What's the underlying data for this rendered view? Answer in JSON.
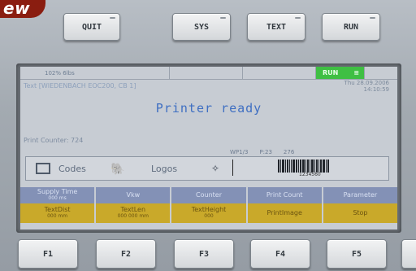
{
  "badge": {
    "text": "ew"
  },
  "top_buttons": [
    "QUIT",
    "SYS",
    "TEXT",
    "RUN"
  ],
  "status": {
    "cell1": "102% 6lbs",
    "run": "RUN"
  },
  "text_line": "Text [WIEDENBACH EOC200, CB 1]",
  "datetime": {
    "date": "Thu 28.09.2006",
    "time": "14:10:59"
  },
  "message": "Printer ready",
  "print_counter": "Print Counter:  724",
  "metrics": [
    "WP1/3",
    "P:23",
    "276"
  ],
  "preview": {
    "codes": "Codes",
    "logos": "Logos",
    "barcode_number": "1234560"
  },
  "softkeys_row1": [
    {
      "label": "Supply Time",
      "sub": "000 ms"
    },
    {
      "label": "Vkw",
      "sub": ""
    },
    {
      "label": "Counter",
      "sub": ""
    },
    {
      "label": "Print Count",
      "sub": ""
    },
    {
      "label": "Parameter",
      "sub": ""
    }
  ],
  "softkeys_row2": [
    {
      "label": "TextDist",
      "sub": "000 mm"
    },
    {
      "label": "TextLen",
      "sub": "000 000 mm"
    },
    {
      "label": "TextHeight",
      "sub": "000"
    },
    {
      "label": "PrintImage",
      "sub": ""
    },
    {
      "label": "Stop",
      "sub": ""
    }
  ],
  "function_keys": [
    "F1",
    "F2",
    "F3",
    "F4",
    "F5"
  ]
}
